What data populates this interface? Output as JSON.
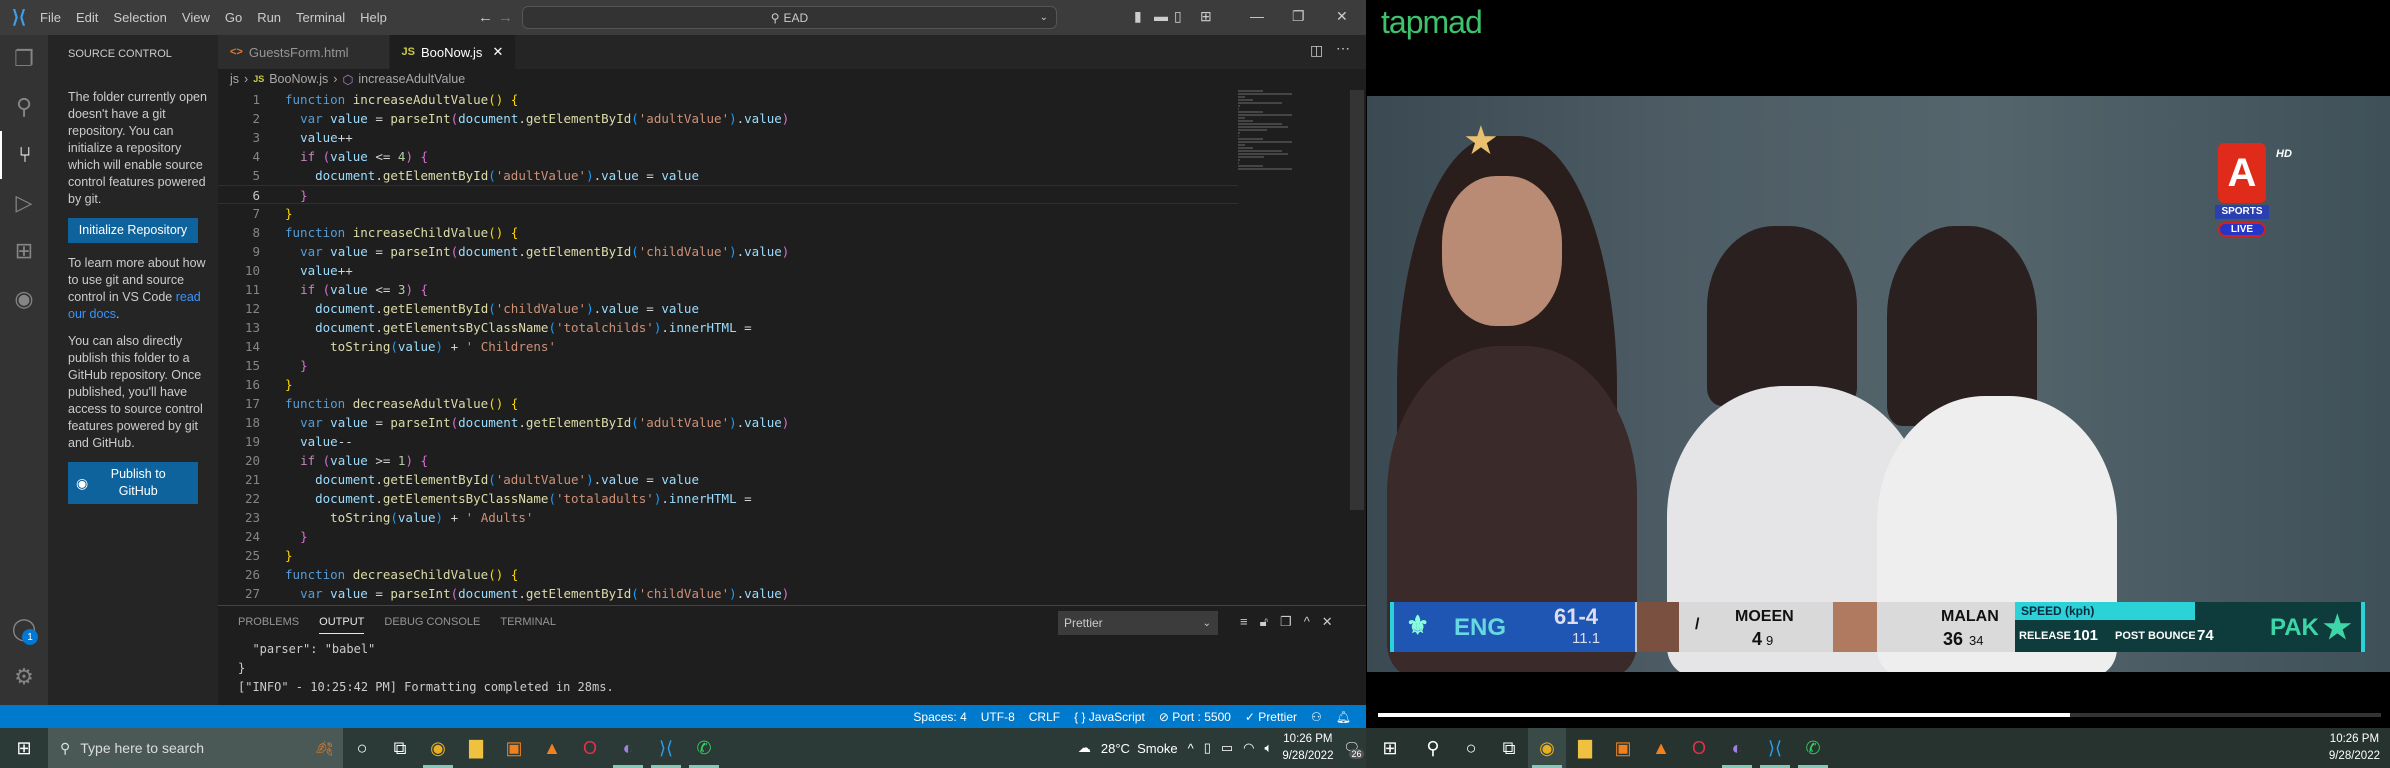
{
  "titlebar": {
    "menu": [
      "File",
      "Edit",
      "Selection",
      "View",
      "Go",
      "Run",
      "Terminal",
      "Help"
    ],
    "command_center": "EAD"
  },
  "sidebar": {
    "title": "SOURCE CONTROL",
    "intro": "The folder currently open doesn't have a git repository. You can initialize a repository which will enable source control features powered by git.",
    "init_button": "Initialize Repository",
    "learn_prefix": "To learn more about how to use git and source control in VS Code ",
    "learn_link": "read our docs",
    "learn_suffix": ".",
    "publish_text": "You can also directly publish this folder to a GitHub repository. Once published, you'll have access to source control features powered by git and GitHub.",
    "publish_button": "Publish to GitHub",
    "accounts_badge": "1"
  },
  "tabs": [
    {
      "label": "GuestsForm.html",
      "icon": "<>",
      "active": false
    },
    {
      "label": "BooNow.js",
      "icon": "JS",
      "active": true
    }
  ],
  "breadcrumb": {
    "folder": "js",
    "file": "BooNow.js",
    "symbol": "increaseAdultValue"
  },
  "editor": {
    "current_line": 6,
    "lines": [
      [
        [
          "function ",
          "k"
        ],
        [
          "increaseAdultValue",
          "f"
        ],
        [
          "() {",
          "b1"
        ]
      ],
      [
        [
          "  ",
          ""
        ],
        [
          "var ",
          "k"
        ],
        [
          "value",
          "v"
        ],
        [
          " = ",
          "p"
        ],
        [
          "parseInt",
          "f"
        ],
        [
          "(",
          "b2"
        ],
        [
          "document",
          "v"
        ],
        [
          ".",
          "p"
        ],
        [
          "getElementById",
          "f"
        ],
        [
          "(",
          "b3"
        ],
        [
          "'adultValue'",
          "s"
        ],
        [
          ")",
          "b3"
        ],
        [
          ".",
          "p"
        ],
        [
          "value",
          "v"
        ],
        [
          ")",
          "b2"
        ]
      ],
      [
        [
          "  ",
          ""
        ],
        [
          "value",
          "v"
        ],
        [
          "++",
          "p"
        ]
      ],
      [
        [
          "  ",
          ""
        ],
        [
          "if ",
          "c"
        ],
        [
          "(",
          "b2"
        ],
        [
          "value",
          "v"
        ],
        [
          " <= ",
          "p"
        ],
        [
          "4",
          "n"
        ],
        [
          ")",
          "b2"
        ],
        [
          " ",
          ""
        ],
        [
          "{",
          "b2"
        ]
      ],
      [
        [
          "    ",
          ""
        ],
        [
          "document",
          "v"
        ],
        [
          ".",
          "p"
        ],
        [
          "getElementById",
          "f"
        ],
        [
          "(",
          "b3"
        ],
        [
          "'adultValue'",
          "s"
        ],
        [
          ")",
          "b3"
        ],
        [
          ".",
          "p"
        ],
        [
          "value",
          "v"
        ],
        [
          " = ",
          "p"
        ],
        [
          "value",
          "v"
        ]
      ],
      [
        [
          "  ",
          ""
        ],
        [
          "}",
          "b2"
        ]
      ],
      [
        [
          "}",
          "b1"
        ]
      ],
      [
        [
          "function ",
          "k"
        ],
        [
          "increaseChildValue",
          "f"
        ],
        [
          "() {",
          "b1"
        ]
      ],
      [
        [
          "  ",
          ""
        ],
        [
          "var ",
          "k"
        ],
        [
          "value",
          "v"
        ],
        [
          " = ",
          "p"
        ],
        [
          "parseInt",
          "f"
        ],
        [
          "(",
          "b2"
        ],
        [
          "document",
          "v"
        ],
        [
          ".",
          "p"
        ],
        [
          "getElementById",
          "f"
        ],
        [
          "(",
          "b3"
        ],
        [
          "'childValue'",
          "s"
        ],
        [
          ")",
          "b3"
        ],
        [
          ".",
          "p"
        ],
        [
          "value",
          "v"
        ],
        [
          ")",
          "b2"
        ]
      ],
      [
        [
          "  ",
          ""
        ],
        [
          "value",
          "v"
        ],
        [
          "++",
          "p"
        ]
      ],
      [
        [
          "  ",
          ""
        ],
        [
          "if ",
          "c"
        ],
        [
          "(",
          "b2"
        ],
        [
          "value",
          "v"
        ],
        [
          " <= ",
          "p"
        ],
        [
          "3",
          "n"
        ],
        [
          ")",
          "b2"
        ],
        [
          " ",
          ""
        ],
        [
          "{",
          "b2"
        ]
      ],
      [
        [
          "    ",
          ""
        ],
        [
          "document",
          "v"
        ],
        [
          ".",
          "p"
        ],
        [
          "getElementById",
          "f"
        ],
        [
          "(",
          "b3"
        ],
        [
          "'childValue'",
          "s"
        ],
        [
          ")",
          "b3"
        ],
        [
          ".",
          "p"
        ],
        [
          "value",
          "v"
        ],
        [
          " = ",
          "p"
        ],
        [
          "value",
          "v"
        ]
      ],
      [
        [
          "    ",
          ""
        ],
        [
          "document",
          "v"
        ],
        [
          ".",
          "p"
        ],
        [
          "getElementsByClassName",
          "f"
        ],
        [
          "(",
          "b3"
        ],
        [
          "'totalchilds'",
          "s"
        ],
        [
          ")",
          "b3"
        ],
        [
          ".",
          "p"
        ],
        [
          "innerHTML",
          "v"
        ],
        [
          " =",
          "p"
        ]
      ],
      [
        [
          "      ",
          ""
        ],
        [
          "toString",
          "f"
        ],
        [
          "(",
          "b3"
        ],
        [
          "value",
          "v"
        ],
        [
          ")",
          "b3"
        ],
        [
          " + ",
          "p"
        ],
        [
          "' Childrens'",
          "s"
        ]
      ],
      [
        [
          "  ",
          ""
        ],
        [
          "}",
          "b2"
        ]
      ],
      [
        [
          "}",
          "b1"
        ]
      ],
      [
        [
          "function ",
          "k"
        ],
        [
          "decreaseAdultValue",
          "f"
        ],
        [
          "() {",
          "b1"
        ]
      ],
      [
        [
          "  ",
          ""
        ],
        [
          "var ",
          "k"
        ],
        [
          "value",
          "v"
        ],
        [
          " = ",
          "p"
        ],
        [
          "parseInt",
          "f"
        ],
        [
          "(",
          "b2"
        ],
        [
          "document",
          "v"
        ],
        [
          ".",
          "p"
        ],
        [
          "getElementById",
          "f"
        ],
        [
          "(",
          "b3"
        ],
        [
          "'adultValue'",
          "s"
        ],
        [
          ")",
          "b3"
        ],
        [
          ".",
          "p"
        ],
        [
          "value",
          "v"
        ],
        [
          ")",
          "b2"
        ]
      ],
      [
        [
          "  ",
          ""
        ],
        [
          "value",
          "v"
        ],
        [
          "--",
          "p"
        ]
      ],
      [
        [
          "  ",
          ""
        ],
        [
          "if ",
          "c"
        ],
        [
          "(",
          "b2"
        ],
        [
          "value",
          "v"
        ],
        [
          " >= ",
          "p"
        ],
        [
          "1",
          "n"
        ],
        [
          ")",
          "b2"
        ],
        [
          " ",
          ""
        ],
        [
          "{",
          "b2"
        ]
      ],
      [
        [
          "    ",
          ""
        ],
        [
          "document",
          "v"
        ],
        [
          ".",
          "p"
        ],
        [
          "getElementById",
          "f"
        ],
        [
          "(",
          "b3"
        ],
        [
          "'adultValue'",
          "s"
        ],
        [
          ")",
          "b3"
        ],
        [
          ".",
          "p"
        ],
        [
          "value",
          "v"
        ],
        [
          " = ",
          "p"
        ],
        [
          "value",
          "v"
        ]
      ],
      [
        [
          "    ",
          ""
        ],
        [
          "document",
          "v"
        ],
        [
          ".",
          "p"
        ],
        [
          "getElementsByClassName",
          "f"
        ],
        [
          "(",
          "b3"
        ],
        [
          "'totaladults'",
          "s"
        ],
        [
          ")",
          "b3"
        ],
        [
          ".",
          "p"
        ],
        [
          "innerHTML",
          "v"
        ],
        [
          " =",
          "p"
        ]
      ],
      [
        [
          "      ",
          ""
        ],
        [
          "toString",
          "f"
        ],
        [
          "(",
          "b3"
        ],
        [
          "value",
          "v"
        ],
        [
          ")",
          "b3"
        ],
        [
          " + ",
          "p"
        ],
        [
          "' Adults'",
          "s"
        ]
      ],
      [
        [
          "  ",
          ""
        ],
        [
          "}",
          "b2"
        ]
      ],
      [
        [
          "}",
          "b1"
        ]
      ],
      [
        [
          "function ",
          "k"
        ],
        [
          "decreaseChildValue",
          "f"
        ],
        [
          "() {",
          "b1"
        ]
      ],
      [
        [
          "  ",
          ""
        ],
        [
          "var ",
          "k"
        ],
        [
          "value",
          "v"
        ],
        [
          " = ",
          "p"
        ],
        [
          "parseInt",
          "f"
        ],
        [
          "(",
          "b2"
        ],
        [
          "document",
          "v"
        ],
        [
          ".",
          "p"
        ],
        [
          "getElementById",
          "f"
        ],
        [
          "(",
          "b3"
        ],
        [
          "'childValue'",
          "s"
        ],
        [
          ")",
          "b3"
        ],
        [
          ".",
          "p"
        ],
        [
          "value",
          "v"
        ],
        [
          ")",
          "b2"
        ]
      ]
    ]
  },
  "panel": {
    "tabs": [
      "PROBLEMS",
      "OUTPUT",
      "DEBUG CONSOLE",
      "TERMINAL"
    ],
    "active_tab": "OUTPUT",
    "output_channel": "Prettier",
    "output_lines": [
      "  \"parser\": \"babel\"",
      "}",
      "[\"INFO\" - 10:25:42 PM] Formatting completed in 28ms."
    ]
  },
  "statusbar": [
    "Spaces: 4",
    "UTF-8",
    "CRLF",
    "{ } JavaScript",
    "⊘ Port : 5500",
    "✓ Prettier"
  ],
  "video": {
    "brand": "tapmad",
    "channel_logo": "A",
    "channel_hd": "HD",
    "channel_sports": "SPORTS",
    "channel_live": "LIVE",
    "progress_percent": 69,
    "scoreboard": {
      "team1": "ENG",
      "score": "61-4",
      "overs": "11.1",
      "batter1": {
        "name": "MOEEN",
        "runs": "4",
        "balls": "9"
      },
      "batter2": {
        "name": "MALAN",
        "runs": "36",
        "balls": "34"
      },
      "speed_title": "SPEED (kph)",
      "release_label": "RELEASE",
      "release": "101",
      "post_bounce_label": "POST BOUNCE",
      "post_bounce": "74",
      "team2": "PAK"
    }
  },
  "taskbar_left": {
    "search_placeholder": "Type here to search",
    "weather": "28°C  Smoke",
    "time": "10:26 PM",
    "date": "9/28/2022",
    "notifications": "26"
  },
  "taskbar_right": {
    "time": "10:26 PM",
    "date": "9/28/2022"
  },
  "colors": {
    "accent": "#007acc",
    "button": "#0e639c",
    "brand": "#3ec36c",
    "eng": "#1f56b4"
  }
}
